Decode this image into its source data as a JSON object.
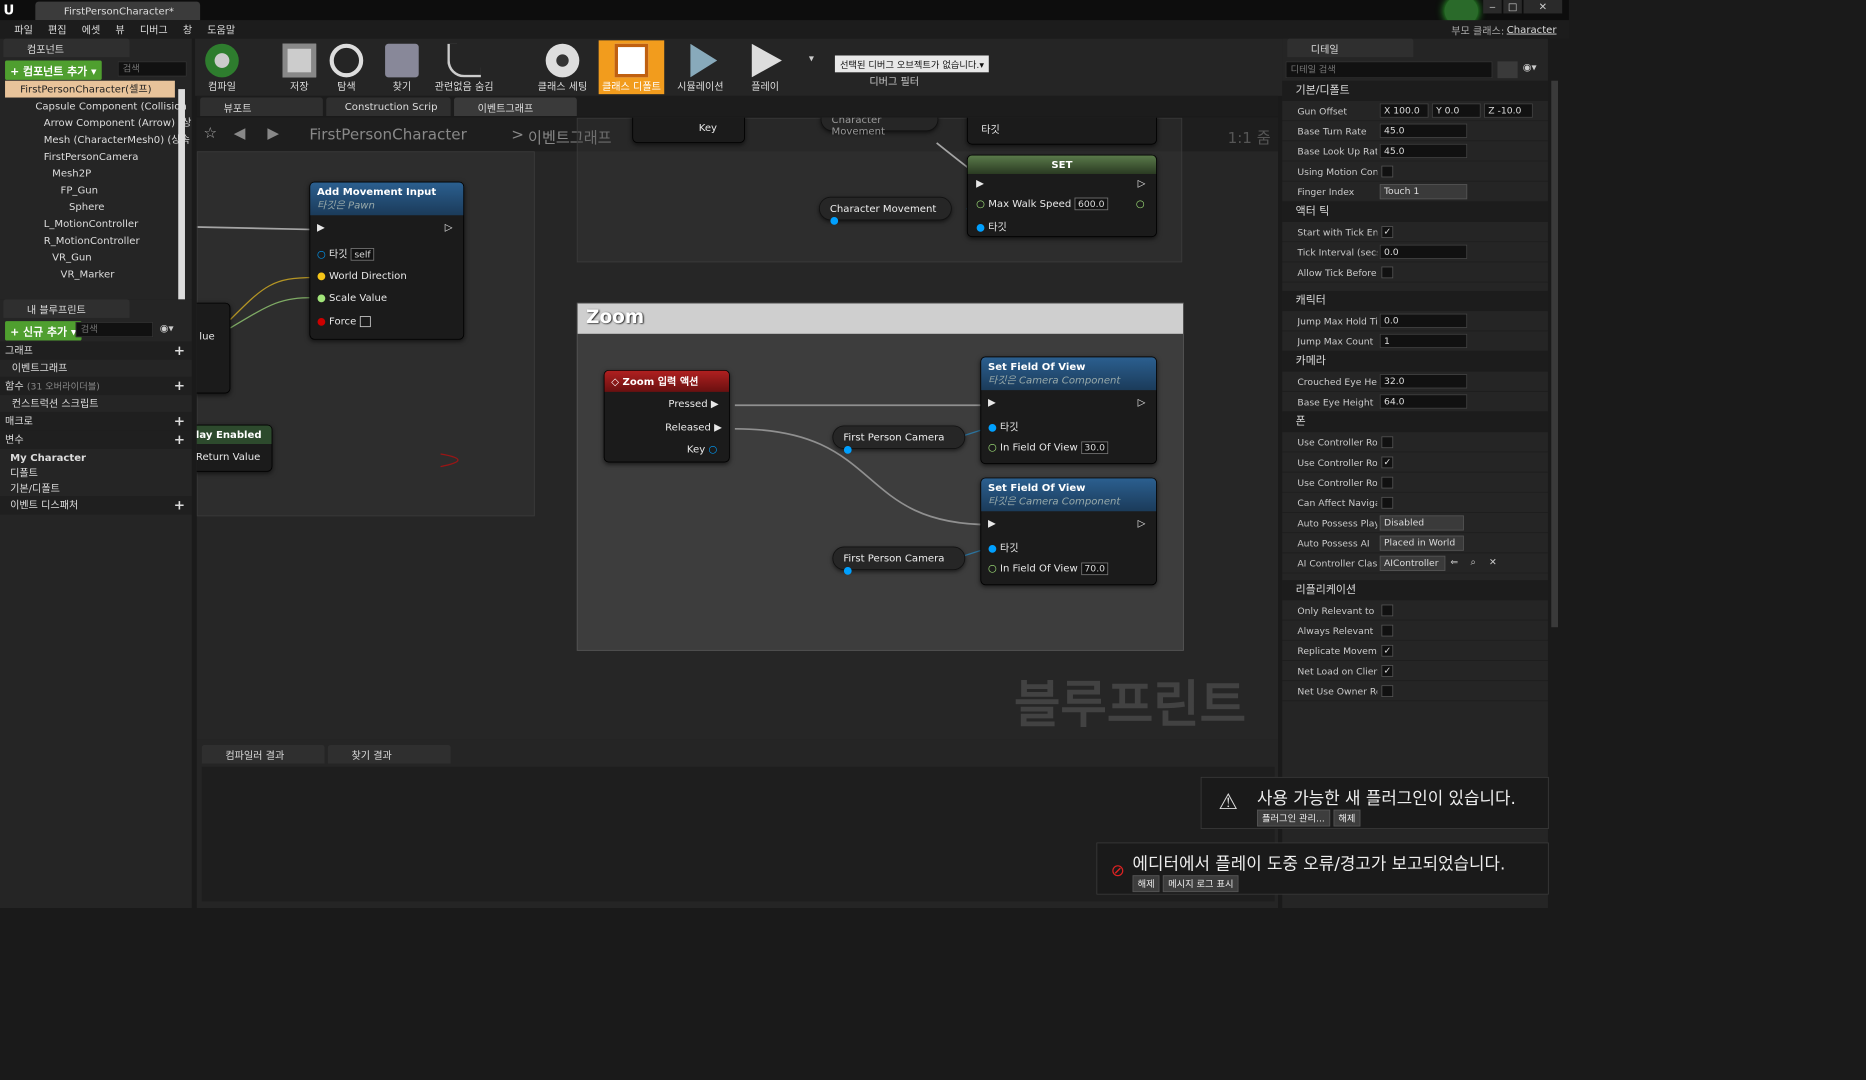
{
  "window": {
    "tab_title": "FirstPersonCharacter*",
    "parent_class_label": "부모 클래스:",
    "parent_class": "Character",
    "min": "‒",
    "max": "□",
    "close": "✕"
  },
  "menu": [
    "파일",
    "편집",
    "에셋",
    "뷰",
    "디버그",
    "창",
    "도움말"
  ],
  "components": {
    "tab": "컴포넌트",
    "add_btn": "+ 컴포넌트 추가 ▾",
    "search_ph": "검색",
    "root": "FirstPersonCharacter(셀프)",
    "items": [
      "Capsule Component (Collision",
      "Arrow Component (Arrow) (상",
      "Mesh (CharacterMesh0) (상속",
      "FirstPersonCamera",
      "Mesh2P",
      "FP_Gun",
      "Sphere",
      "L_MotionController",
      "R_MotionController",
      "VR_Gun",
      "VR_Marker"
    ]
  },
  "mybp": {
    "tab": "내 블루프린트",
    "add_btn": "+ 신규 추가 ▾",
    "search_ph": "검색",
    "graph": "그래프",
    "event_graph": "이벤트그래프",
    "functions": "함수",
    "functions_note": "(31 오버라이더블)",
    "construction": "컨스트럭션 스크립트",
    "macros": "매크로",
    "variables": "변수",
    "var_groups": [
      "My Character",
      "디폴트",
      "기본/디폴트"
    ],
    "dispatchers": "이벤트 디스패처"
  },
  "toolbar": {
    "buttons": [
      "컴파일",
      "저장",
      "탐색",
      "찾기",
      "관련없음 숨김",
      "클래스 세팅",
      "클래스 디폴트",
      "시뮬레이션",
      "플레이"
    ],
    "debug_select": "선택된 디버그 오브젝트가 없습니다.▾",
    "debug_label": "디버그 필터"
  },
  "graph_tabs": [
    "뷰포트",
    "Construction Scrip",
    "이벤트그래프"
  ],
  "breadcrumb": {
    "root": "FirstPersonCharacter",
    "sep": ">",
    "current": "이벤트그래프",
    "zoom": "1:1 줌"
  },
  "nodes": {
    "add_move": {
      "title": "Add Movement Input",
      "sub": "타깃은 Pawn",
      "target": "타깃",
      "self": "self",
      "dir": "World Direction",
      "scale": "Scale Value",
      "force": "Force"
    },
    "frag_value": "lue",
    "frag_enabled": "lay Enabled",
    "frag_return": "Return Value",
    "key_top": "Key",
    "char_move_top": "Character Movement",
    "target_top": "타깃",
    "set": {
      "title": "SET",
      "walk": "Max Walk Speed",
      "walk_val": "600.0",
      "target": "타깃"
    },
    "char_move": "Character Movement",
    "zoom_comment": "Zoom",
    "zoom_evt": {
      "title": "Zoom 입력 액션",
      "pressed": "Pressed",
      "released": "Released",
      "key": "Key"
    },
    "fov1": {
      "title": "Set Field Of View",
      "sub": "타깃은 Camera Component",
      "target": "타깃",
      "fov": "In Field Of View",
      "val": "30.0"
    },
    "fov2": {
      "title": "Set Field Of View",
      "sub": "타깃은 Camera Component",
      "target": "타깃",
      "fov": "In Field Of View",
      "val": "70.0"
    },
    "cam1": "First Person Camera",
    "cam2": "First Person Camera",
    "watermark": "블루프린트"
  },
  "bottom": {
    "tabs": [
      "컴파일러 결과",
      "찾기 결과"
    ]
  },
  "details": {
    "tab": "디테일",
    "search_ph": "디테일 검색",
    "sections": {
      "s1": "기본/디폴트",
      "s2": "액터 틱",
      "s3": "캐릭터",
      "s4": "카메라",
      "s5": "폰",
      "s6": "리플리케이션"
    },
    "gun_offset": {
      "label": "Gun Offset",
      "x": "X 100.0",
      "y": "Y 0.0",
      "z": "Z -10.0"
    },
    "rows": {
      "turn": {
        "label": "Base Turn Rate",
        "val": "45.0"
      },
      "lookup": {
        "label": "Base Look Up Rate",
        "val": "45.0"
      },
      "motion": {
        "label": "Using Motion Cont"
      },
      "finger": {
        "label": "Finger Index",
        "val": "Touch 1"
      },
      "tickstart": {
        "label": "Start with Tick Ena"
      },
      "tickint": {
        "label": "Tick Interval (secs",
        "val": "0.0"
      },
      "allowtick": {
        "label": "Allow Tick Before I"
      },
      "jumphold": {
        "label": "Jump Max Hold Ti",
        "val": "0.0"
      },
      "jumpcount": {
        "label": "Jump Max Count",
        "val": "1"
      },
      "crouch": {
        "label": "Crouched Eye Heig",
        "val": "32.0"
      },
      "baseeye": {
        "label": "Base Eye Height",
        "val": "64.0"
      },
      "ucr1": {
        "label": "Use Controller Rot"
      },
      "ucr2": {
        "label": "Use Controller Rot"
      },
      "ucr3": {
        "label": "Use Controller Rot"
      },
      "canaff": {
        "label": "Can Affect Navigat"
      },
      "autopos": {
        "label": "Auto Possess Play",
        "val": "Disabled"
      },
      "autoai": {
        "label": "Auto Possess AI",
        "val": "Placed in World"
      },
      "aiclass": {
        "label": "AI Controller Class",
        "val": "AIController"
      },
      "onlyrel": {
        "label": "Only Relevant to O"
      },
      "alwaysrel": {
        "label": "Always Relevant"
      },
      "repmove": {
        "label": "Replicate Moveme"
      },
      "netload": {
        "label": "Net Load on Client"
      },
      "netowner": {
        "label": "Net Use Owner Rel"
      }
    }
  },
  "toasts": {
    "plugin": {
      "text": "사용 가능한 새 플러그인이 있습니다.",
      "btn1": "플러그인 관리...",
      "btn2": "해제"
    },
    "error": {
      "text": "에디터에서 플레이 도중 오류/경고가 보고되었습니다.",
      "btn1": "해제",
      "btn2": "메시지 로그 표시"
    }
  },
  "colors": {
    "accent": "#f29c1d",
    "green": "#4f9f2f",
    "exec": "#ffffff",
    "object_pin": "#00a0ff",
    "float_pin": "#a2e57a",
    "vector_pin": "#f5c518"
  }
}
